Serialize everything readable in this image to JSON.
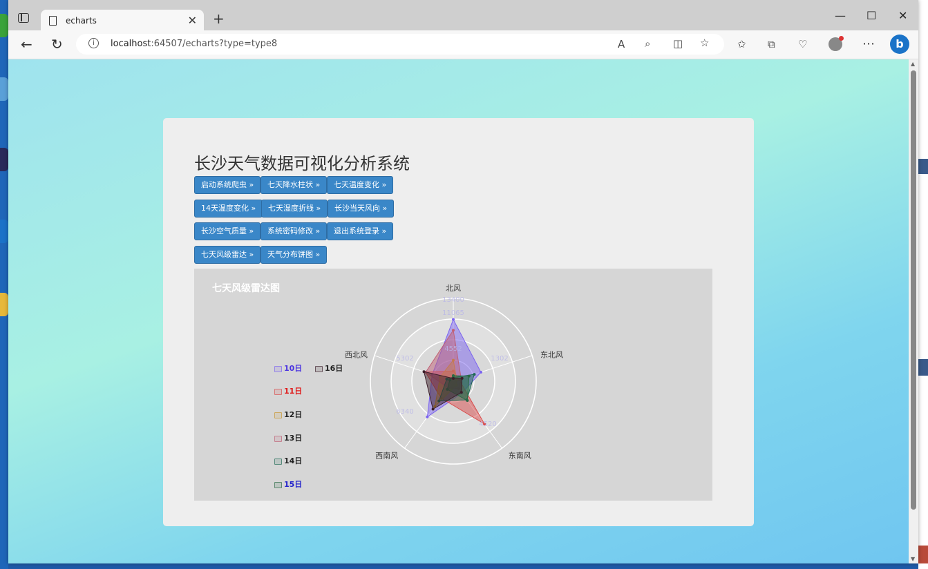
{
  "browser": {
    "tab_title": "echarts",
    "url_host": "localhost",
    "url_rest": ":64507/echarts?type=type8"
  },
  "page": {
    "title": "长沙天气数据可视化分析系统",
    "buttons": [
      "启动系统爬虫 »",
      "七天降水柱状 »",
      "七天温度变化 »",
      "14天温度变化 »",
      "七天湿度折线 »",
      "长沙当天风向 »",
      "长沙空气质量 »",
      "系统密码修改 »",
      "退出系统登录 »",
      "七天风级雷达 »",
      "天气分布饼图 »"
    ]
  },
  "chart_data": {
    "type": "radar",
    "title": "七天风级雷达图",
    "indicators": [
      "北风",
      "东北风",
      "东南风",
      "西南风",
      "西北风"
    ],
    "max": 18000,
    "tick_labels": [
      "13400",
      "11065",
      "4552",
      "1302",
      "5302",
      "6340",
      "4520"
    ],
    "legend_position": "left",
    "series": [
      {
        "name": "10日",
        "color": "#7b63f0",
        "values": [
          13400,
          6302,
          3200,
          9600,
          4800
        ]
      },
      {
        "name": "11日",
        "color": "#d94b4b",
        "values": [
          2200,
          1300,
          11500,
          4520,
          6340
        ]
      },
      {
        "name": "12日",
        "color": "#c9952c",
        "values": [
          4552,
          800,
          1100,
          6800,
          3000
        ]
      },
      {
        "name": "13日",
        "color": "#c06075",
        "values": [
          11065,
          1800,
          2000,
          1800,
          6300
        ]
      },
      {
        "name": "14日",
        "color": "#1f6a55",
        "values": [
          800,
          4800,
          5000,
          5300,
          1500
        ]
      },
      {
        "name": "15日",
        "color": "#2a6a45",
        "values": [
          1200,
          3600,
          5200,
          2200,
          800
        ]
      },
      {
        "name": "16日",
        "color": "#3b1f2a",
        "values": [
          600,
          2000,
          3000,
          7500,
          6700
        ]
      }
    ],
    "legend_text_colors": {
      "10日": "#4a33e0",
      "11日": "#e01818",
      "12日": "#222222",
      "13日": "#222222",
      "14日": "#222222",
      "15日": "#2222cc",
      "16日": "#222222"
    }
  }
}
